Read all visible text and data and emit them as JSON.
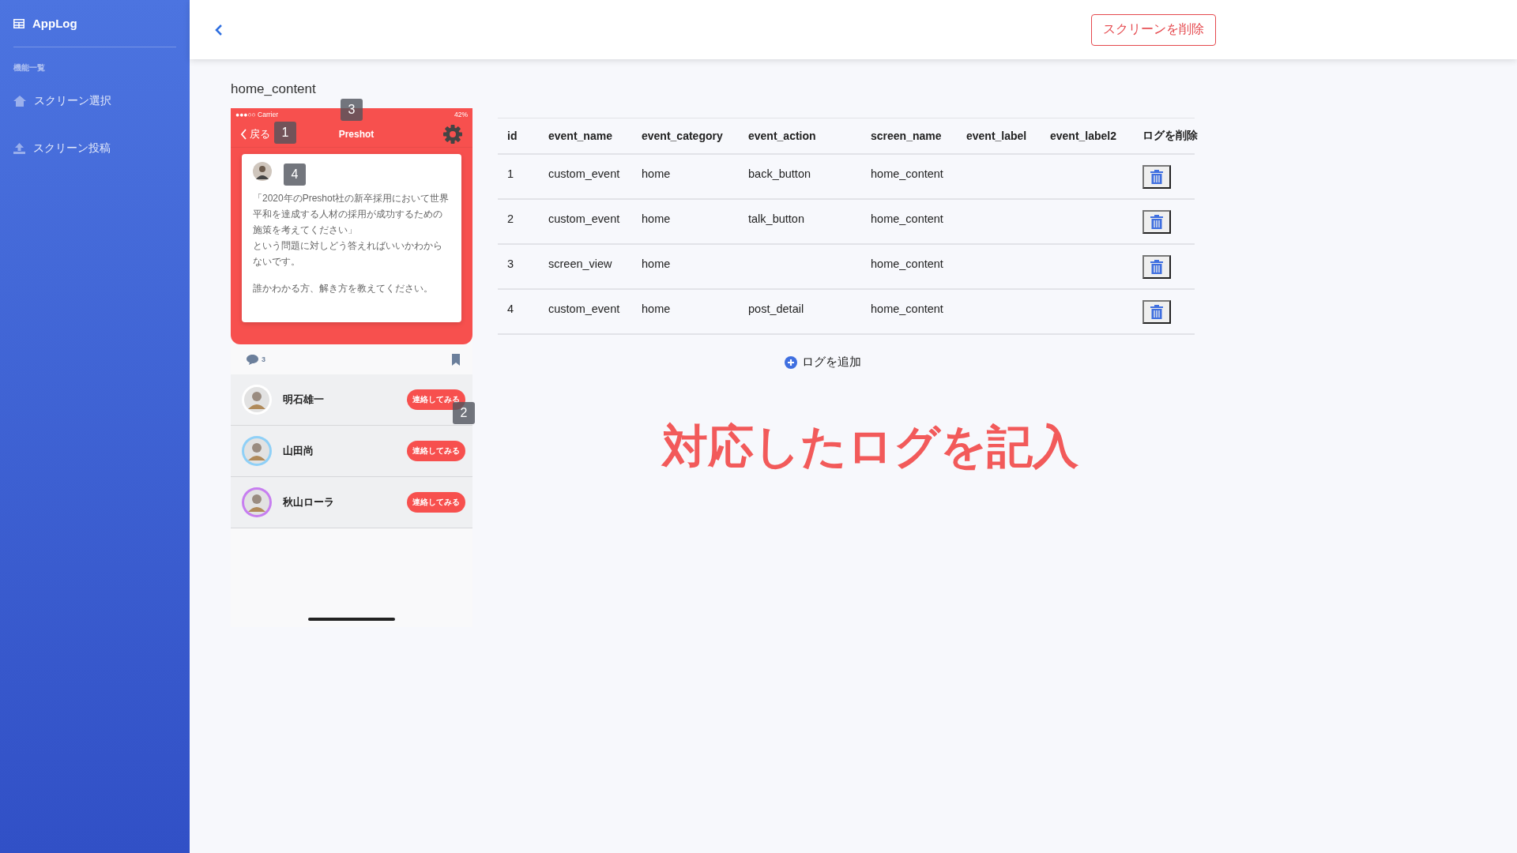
{
  "sidebar": {
    "brand": "AppLog",
    "section": "機能一覧",
    "items": [
      {
        "label": "スクリーン選択",
        "kind": "home"
      },
      {
        "label": "スクリーン投稿",
        "kind": "upload"
      }
    ]
  },
  "header": {
    "delete_button": "スクリーンを削除"
  },
  "screen_title": "home_content",
  "phone": {
    "status": {
      "carrier": "●●●○○ Carrier",
      "battery": "42%"
    },
    "nav": {
      "back": "戻る",
      "title": "Preshot"
    },
    "post": {
      "paragraphs": [
        [
          "「2020年のPreshot社の新卒採用において世界平和を達成する人材の採用が成功するための施策を考えてください」",
          "という問題に対しどう答えればいいかわからないです。"
        ],
        [
          "誰かわかる方、解き方を教えてください。"
        ]
      ]
    },
    "comments": "3",
    "users": [
      {
        "name": "明石雄一",
        "button": "連絡してみる",
        "color": "#ffffff"
      },
      {
        "name": "山田尚",
        "button": "連絡してみる",
        "color": "#8fd0f7"
      },
      {
        "name": "秋山ローラ",
        "button": "連絡してみる",
        "color": "#c77ef0"
      }
    ]
  },
  "markers": [
    "1",
    "2",
    "3",
    "4"
  ],
  "table": {
    "columns": [
      "id",
      "event_name",
      "event_category",
      "event_action",
      "screen_name",
      "event_label",
      "event_label2",
      "ログを削除"
    ],
    "rows": [
      [
        "1",
        "custom_event",
        "home",
        "back_button",
        "home_content",
        "",
        ""
      ],
      [
        "2",
        "custom_event",
        "home",
        "talk_button",
        "home_content",
        "",
        ""
      ],
      [
        "3",
        "screen_view",
        "home",
        "",
        "home_content",
        "",
        ""
      ],
      [
        "4",
        "custom_event",
        "home",
        "post_detail",
        "home_content",
        "",
        ""
      ]
    ]
  },
  "add_log": "ログを追加",
  "note": "対応したログを記入"
}
